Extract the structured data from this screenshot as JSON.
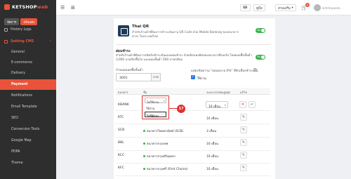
{
  "brand": {
    "name": "KETSHOP",
    "suffix": "web"
  },
  "mode": {
    "active": "จัดการ",
    "other": "ปรับแต่ง"
  },
  "sidebar": {
    "items": [
      {
        "label": "History Logs"
      },
      {
        "label": "Setting CMS"
      },
      {
        "label": "General"
      },
      {
        "label": "E-commerce"
      },
      {
        "label": "Delivery"
      },
      {
        "label": "Payment"
      },
      {
        "label": "Notifications"
      },
      {
        "label": "Email Template"
      },
      {
        "label": "SEO"
      },
      {
        "label": "Conversion Tools"
      },
      {
        "label": "Google Map"
      },
      {
        "label": "PDPA"
      },
      {
        "label": "Theme"
      }
    ]
  },
  "topbar": {
    "language": "คู่มือ",
    "store_menu": "ส่วนเสริม",
    "cart_count": "0",
    "user_name": "ketshopweb..."
  },
  "qr": {
    "title": "Thai QR",
    "description": "สำหรับร้านค้าที่ต้องการชำระเงินผ่าน QR Code ด้วย Mobile Banking ของธนาคารต่างๆ ในประเทศไทย",
    "toggle": "เปิด"
  },
  "installment": {
    "title": "ผ่อนชำระ",
    "description": "สำหรับร้านค้าที่ต้องการเปิดรับชำระเงินแบบผ่อนชำระ ด้วยบัตรเครดิตของธนาคารที่รองรับ โดยยอดซื้อขั้นต่ำ 3,000 บาท/บิลขึ้นไป และผ่อนขั้นต่ำ 500 บาท/เดือน",
    "toggle": "เปิด",
    "min_label": "กำหนดยอดซื้อขั้นต่ำ",
    "min_value": "3001",
    "min_unit": "บาท",
    "rate_label": "แสดงข้อความ \"ผ่อนสบาย 0%\" ที่ตัวเลือกชำระเงิน",
    "checkbox_label": "ใช้งาน"
  },
  "table": {
    "headers": [
      "ธนาคาร",
      "ชื่อ",
      "ระยะเวลาผ่อนสูงสุด",
      "แก้ไข"
    ],
    "rows": [
      {
        "code": "KBANK",
        "name": "",
        "term": "10 เดือน"
      },
      {
        "code": "KTC",
        "name": "",
        "term": "10 เดือน"
      },
      {
        "code": "SCB",
        "name": "ธนาคารไทยพาณิชย์ (SCB)",
        "term": "3 เดือน"
      },
      {
        "code": "BBL",
        "name": "ธนาคารกรุงเทพ",
        "term": "10 เดือน"
      },
      {
        "code": "KCC",
        "name": "ธนาคารกรุงศรีอยุธยา",
        "term": "10 เดือน"
      },
      {
        "code": "KFC",
        "name": "ธนาคารกรุงศรี (First Choice)",
        "term": "10 เดือน"
      }
    ]
  },
  "dropdown": {
    "selected": "ไม่ใช้งาน",
    "options": [
      "ใช้งาน",
      "ไม่ใช้งาน"
    ]
  },
  "callout": "17",
  "colors": {
    "accent": "#e8533a",
    "success": "#37b24d",
    "annotation": "#e03131"
  }
}
